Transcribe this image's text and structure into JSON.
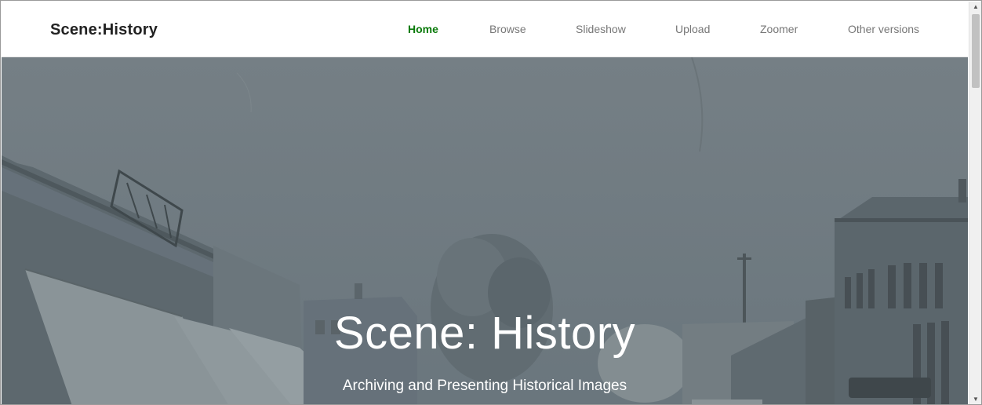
{
  "header": {
    "brand": "Scene:History",
    "nav": [
      {
        "label": "Home",
        "active": true
      },
      {
        "label": "Browse",
        "active": false
      },
      {
        "label": "Slideshow",
        "active": false
      },
      {
        "label": "Upload",
        "active": false
      },
      {
        "label": "Zoomer",
        "active": false
      },
      {
        "label": "Other versions",
        "active": false
      }
    ]
  },
  "hero": {
    "title": "Scene: History",
    "subtitle": "Archiving and Presenting Historical Images",
    "overlay_color": "#6f7b82"
  },
  "colors": {
    "active_nav": "#0a7a0a",
    "nav_text": "#777777",
    "brand_text": "#222222"
  },
  "icons": {
    "scroll_up": "triangle-up-icon",
    "scroll_down": "triangle-down-icon"
  }
}
